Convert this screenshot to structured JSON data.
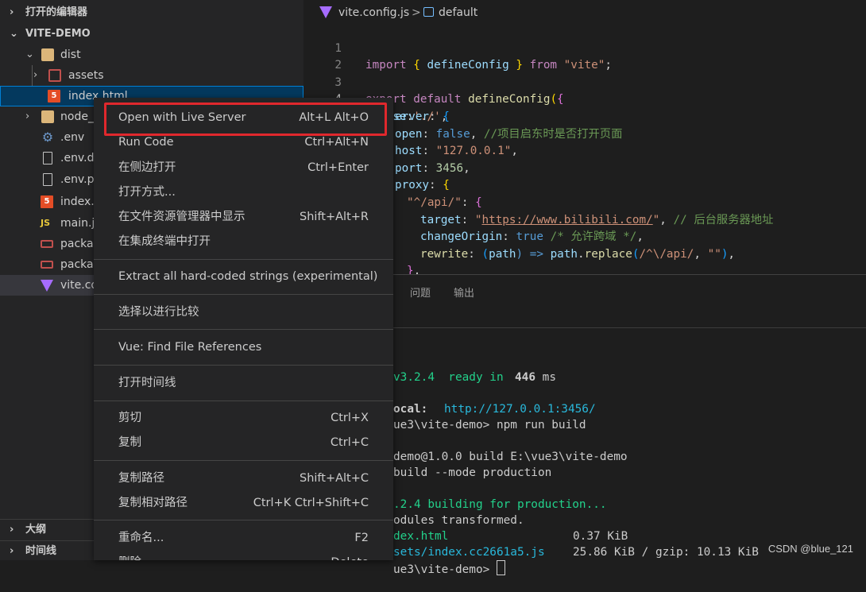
{
  "sidebar": {
    "open_editors_label": "打开的编辑器",
    "project_label": "VITE-DEMO",
    "items": [
      {
        "name": "dist"
      },
      {
        "name": "assets"
      },
      {
        "name": "index.html"
      },
      {
        "name": "node_"
      },
      {
        "name": ".env"
      },
      {
        "name": ".env.de"
      },
      {
        "name": ".env.pr"
      },
      {
        "name": "index."
      },
      {
        "name": "main.j"
      },
      {
        "name": "packag"
      },
      {
        "name": "packag"
      },
      {
        "name": "vite.co"
      }
    ],
    "outline_label": "大纲",
    "timeline_label": "时间线"
  },
  "breadcrumb": {
    "file": "vite.config.js",
    "separator": ">",
    "symbol": "default"
  },
  "code": {
    "active_line": "4",
    "lines": [
      {
        "no": "1",
        "t": [
          "import",
          " { ",
          "defineConfig",
          " } ",
          "from",
          " ",
          "\"vite\"",
          ";"
        ]
      },
      {
        "no": "2"
      },
      {
        "no": "3",
        "t": [
          "export",
          " ",
          "default",
          " ",
          "defineConfig",
          "(",
          "{"
        ]
      },
      {
        "no": "4",
        "t": [
          "  ",
          "base",
          ":",
          "'./'",
          ","
        ]
      },
      {
        "no": "",
        "t": [
          "erver",
          ": ",
          "{"
        ]
      },
      {
        "no": "",
        "t": [
          "open",
          ": ",
          "false",
          ", ",
          "//项目启东时是否打开页面"
        ]
      },
      {
        "no": "",
        "t": [
          "host",
          ": ",
          "\"127.0.0.1\"",
          ","
        ]
      },
      {
        "no": "",
        "t": [
          "port",
          ": ",
          "3456",
          ","
        ]
      },
      {
        "no": "",
        "t": [
          "proxy",
          ": ",
          "{"
        ]
      },
      {
        "no": "",
        "t": [
          "\"^/api/\"",
          ": ",
          "{"
        ]
      },
      {
        "no": "",
        "t": [
          "target",
          ": ",
          "\"",
          "https://www.bilibili.com/",
          "\"",
          ", ",
          "// 后台服务器地址"
        ]
      },
      {
        "no": "",
        "t": [
          "changeOrigin",
          ": ",
          "true",
          " ",
          "/* 允许跨域 */",
          ","
        ]
      },
      {
        "no": "",
        "t": [
          "rewrite",
          ": ",
          "(",
          "path",
          ") => ",
          "path",
          ".",
          "replace",
          "(",
          "/^\\/api/",
          ", ",
          "\"\"",
          ")",
          ","
        ]
      },
      {
        "no": "",
        "t": [
          "}",
          ","
        ]
      },
      {
        "no": "",
        "t": [
          "}"
        ]
      }
    ]
  },
  "panel": {
    "tabs": [
      "问题",
      "输出"
    ],
    "terminal": [
      "v3.2.4  ready in ",
      "446",
      " ms",
      "ocal:",
      "http://127.0.0.1:3456/",
      "ue3\\vite-demo> npm run build",
      "demo@1.0.0 build E:\\vue3\\vite-demo",
      "build --mode production",
      ".2.4 building for production...",
      "odules transformed.",
      "dex.html",
      "0.37 KiB",
      "sets/index.cc2661a5.js",
      "25.86 KiB / gzip: 10.13 KiB",
      "ue3\\vite-demo> "
    ],
    "watermark": "CSDN @blue_121"
  },
  "menu": {
    "items": [
      {
        "label": "Open with Live Server",
        "key": "Alt+L Alt+O"
      },
      {
        "label": "Run Code",
        "key": "Ctrl+Alt+N"
      },
      {
        "label": "在侧边打开",
        "key": "Ctrl+Enter"
      },
      {
        "label": "打开方式...",
        "key": ""
      },
      {
        "label": "在文件资源管理器中显示",
        "key": "Shift+Alt+R"
      },
      {
        "label": "在集成终端中打开",
        "key": ""
      },
      {
        "label": "Extract all hard-coded strings (experimental)",
        "key": ""
      },
      {
        "label": "选择以进行比较",
        "key": ""
      },
      {
        "label": "Vue: Find File References",
        "key": ""
      },
      {
        "label": "打开时间线",
        "key": ""
      },
      {
        "label": "剪切",
        "key": "Ctrl+X"
      },
      {
        "label": "复制",
        "key": "Ctrl+C"
      },
      {
        "label": "复制路径",
        "key": "Shift+Alt+C"
      },
      {
        "label": "复制相对路径",
        "key": "Ctrl+K Ctrl+Shift+C"
      },
      {
        "label": "重命名...",
        "key": "F2"
      },
      {
        "label": "删除",
        "key": "Delete"
      }
    ]
  },
  "colors": {
    "highlight_border": "#e0282d",
    "background": "#1e1e1e",
    "sidebar": "#252526"
  }
}
